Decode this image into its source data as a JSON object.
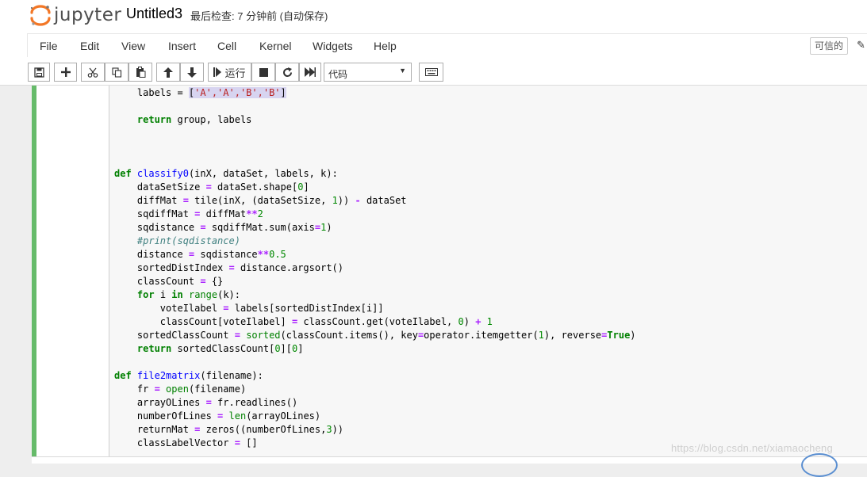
{
  "header": {
    "logo_text": "jupyter",
    "notebook_name": "Untitled3",
    "checkpoint": "最后检查: 7 分钟前  (自动保存)",
    "logo_color": "#f37726"
  },
  "menu": {
    "items": [
      "File",
      "Edit",
      "View",
      "Insert",
      "Cell",
      "Kernel",
      "Widgets",
      "Help"
    ],
    "trusted_label": "可信的"
  },
  "toolbar": {
    "run_label": "运行",
    "cell_type": "代码",
    "icons": [
      "save-icon",
      "plus-icon",
      "cut-icon",
      "copy-icon",
      "paste-icon",
      "arrow-up-icon",
      "arrow-down-icon",
      "step-forward-icon",
      "stop-icon",
      "restart-icon",
      "fast-forward-icon",
      "keyboard-icon"
    ]
  },
  "code": {
    "lines": [
      [
        {
          "t": "    labels = "
        },
        {
          "t": "[",
          "c": "sel"
        },
        {
          "t": "'A','A','B','B'",
          "c": "st sel"
        },
        {
          "t": "]",
          "c": "sel"
        }
      ],
      [],
      [
        {
          "t": "    "
        },
        {
          "t": "return",
          "c": "kw"
        },
        {
          "t": " group, labels"
        }
      ],
      [],
      [],
      [],
      [
        {
          "t": "def",
          "c": "kw"
        },
        {
          "t": " "
        },
        {
          "t": "classify0",
          "c": "fn"
        },
        {
          "t": "(inX, dataSet, labels, k):"
        }
      ],
      [
        {
          "t": "    dataSetSize "
        },
        {
          "t": "=",
          "c": "op"
        },
        {
          "t": " dataSet.shape["
        },
        {
          "t": "0",
          "c": "nm"
        },
        {
          "t": "]"
        }
      ],
      [
        {
          "t": "    diffMat "
        },
        {
          "t": "=",
          "c": "op"
        },
        {
          "t": " tile(inX, (dataSetSize, "
        },
        {
          "t": "1",
          "c": "nm"
        },
        {
          "t": ")) "
        },
        {
          "t": "-",
          "c": "op"
        },
        {
          "t": " dataSet"
        }
      ],
      [
        {
          "t": "    sqdiffMat "
        },
        {
          "t": "=",
          "c": "op"
        },
        {
          "t": " diffMat"
        },
        {
          "t": "**",
          "c": "op"
        },
        {
          "t": "2",
          "c": "nm"
        }
      ],
      [
        {
          "t": "    sqdistance "
        },
        {
          "t": "=",
          "c": "op"
        },
        {
          "t": " sqdiffMat.sum(axis"
        },
        {
          "t": "=",
          "c": "op"
        },
        {
          "t": "1",
          "c": "nm"
        },
        {
          "t": ")"
        }
      ],
      [
        {
          "t": "    "
        },
        {
          "t": "#print(sqdistance)",
          "c": "cm"
        }
      ],
      [
        {
          "t": "    distance "
        },
        {
          "t": "=",
          "c": "op"
        },
        {
          "t": " sqdistance"
        },
        {
          "t": "**",
          "c": "op"
        },
        {
          "t": "0.5",
          "c": "nm"
        }
      ],
      [
        {
          "t": "    sortedDistIndex "
        },
        {
          "t": "=",
          "c": "op"
        },
        {
          "t": " distance.argsort()"
        }
      ],
      [
        {
          "t": "    classCount "
        },
        {
          "t": "=",
          "c": "op"
        },
        {
          "t": " {}"
        }
      ],
      [
        {
          "t": "    "
        },
        {
          "t": "for",
          "c": "kw"
        },
        {
          "t": " i "
        },
        {
          "t": "in",
          "c": "kw"
        },
        {
          "t": " "
        },
        {
          "t": "range",
          "c": "bi"
        },
        {
          "t": "(k):"
        }
      ],
      [
        {
          "t": "        voteIlabel "
        },
        {
          "t": "=",
          "c": "op"
        },
        {
          "t": " labels[sortedDistIndex[i]]"
        }
      ],
      [
        {
          "t": "        classCount[voteIlabel] "
        },
        {
          "t": "=",
          "c": "op"
        },
        {
          "t": " classCount.get(voteIlabel, "
        },
        {
          "t": "0",
          "c": "nm"
        },
        {
          "t": ") "
        },
        {
          "t": "+",
          "c": "op"
        },
        {
          "t": " "
        },
        {
          "t": "1",
          "c": "nm"
        }
      ],
      [
        {
          "t": "    sortedClassCount "
        },
        {
          "t": "=",
          "c": "op"
        },
        {
          "t": " "
        },
        {
          "t": "sorted",
          "c": "bi"
        },
        {
          "t": "(classCount.items(), key"
        },
        {
          "t": "=",
          "c": "op"
        },
        {
          "t": "operator.itemgetter("
        },
        {
          "t": "1",
          "c": "nm"
        },
        {
          "t": "), reverse"
        },
        {
          "t": "=",
          "c": "op"
        },
        {
          "t": "True",
          "c": "kw"
        },
        {
          "t": ")"
        }
      ],
      [
        {
          "t": "    "
        },
        {
          "t": "return",
          "c": "kw"
        },
        {
          "t": " sortedClassCount["
        },
        {
          "t": "0",
          "c": "nm"
        },
        {
          "t": "]["
        },
        {
          "t": "0",
          "c": "nm"
        },
        {
          "t": "]"
        }
      ],
      [],
      [
        {
          "t": "def",
          "c": "kw"
        },
        {
          "t": " "
        },
        {
          "t": "file2matrix",
          "c": "fn"
        },
        {
          "t": "(filename):"
        }
      ],
      [
        {
          "t": "    fr "
        },
        {
          "t": "=",
          "c": "op"
        },
        {
          "t": " "
        },
        {
          "t": "open",
          "c": "bi"
        },
        {
          "t": "(filename)"
        }
      ],
      [
        {
          "t": "    arrayOLines "
        },
        {
          "t": "=",
          "c": "op"
        },
        {
          "t": " fr.readlines()"
        }
      ],
      [
        {
          "t": "    numberOfLines "
        },
        {
          "t": "=",
          "c": "op"
        },
        {
          "t": " "
        },
        {
          "t": "len",
          "c": "bi"
        },
        {
          "t": "(arrayOLines)"
        }
      ],
      [
        {
          "t": "    returnMat "
        },
        {
          "t": "=",
          "c": "op"
        },
        {
          "t": " zeros((numberOfLines,"
        },
        {
          "t": "3",
          "c": "nm"
        },
        {
          "t": "))"
        }
      ],
      [
        {
          "t": "    classLabelVector "
        },
        {
          "t": "=",
          "c": "op"
        },
        {
          "t": " []"
        }
      ]
    ]
  },
  "watermark": "https://blog.csdn.net/xiamaocheng"
}
